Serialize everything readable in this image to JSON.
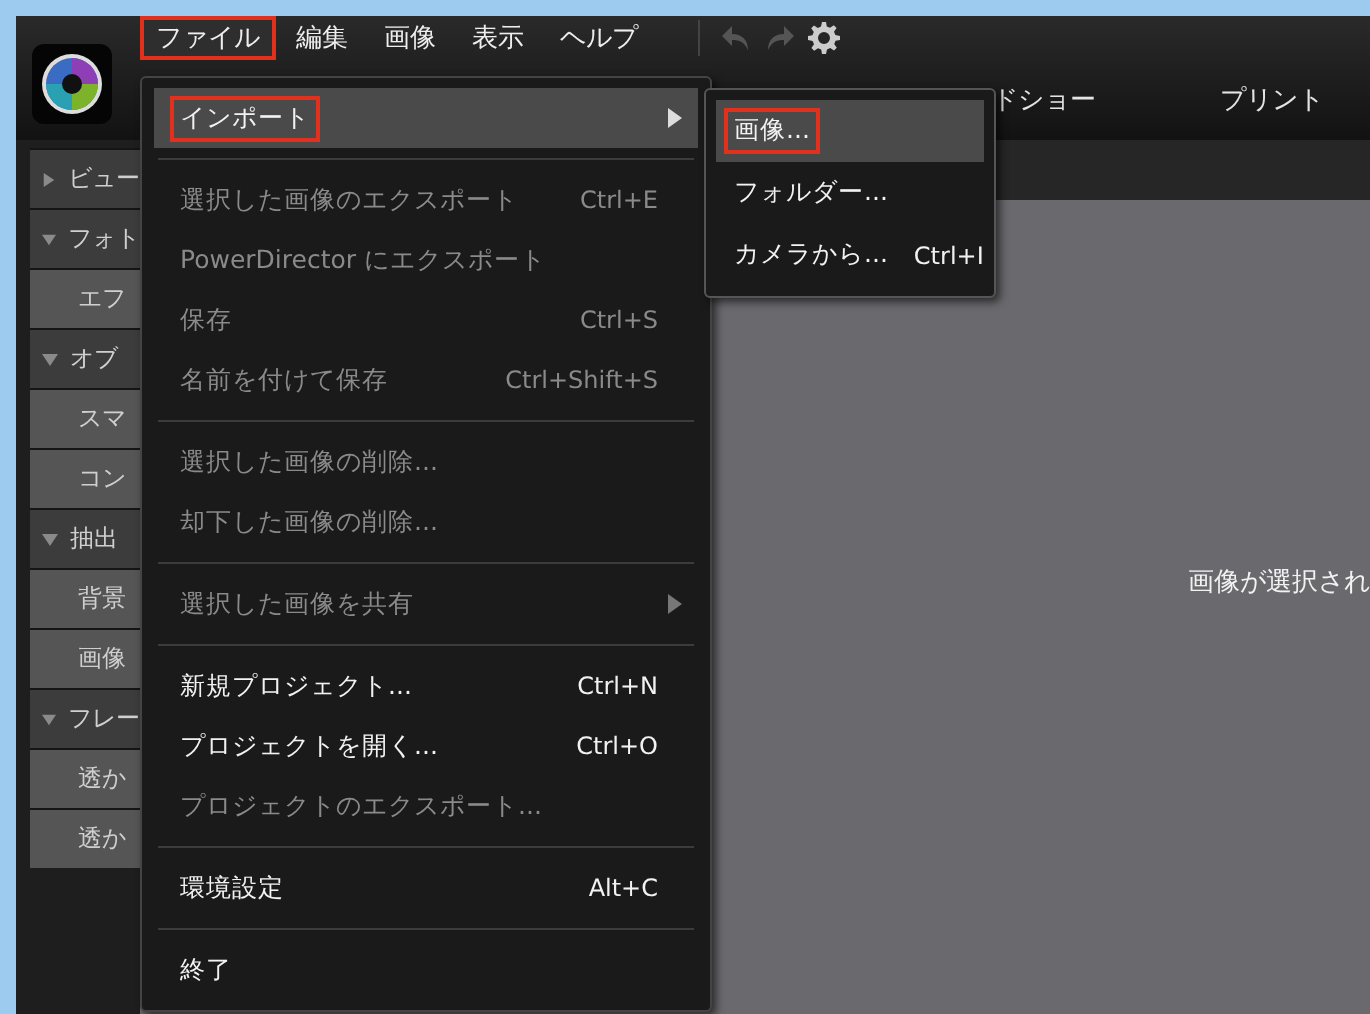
{
  "menubar": [
    {
      "label": "ファイル",
      "selected": true,
      "annotated": true
    },
    {
      "label": "編集",
      "selected": false,
      "annotated": false
    },
    {
      "label": "画像",
      "selected": false,
      "annotated": false
    },
    {
      "label": "表示",
      "selected": false,
      "annotated": false
    },
    {
      "label": "ヘルプ",
      "selected": false,
      "annotated": false
    }
  ],
  "tabs": [
    {
      "label": "ドショー",
      "selected": false
    },
    {
      "label": "プリント",
      "selected": false
    }
  ],
  "sidebar": [
    {
      "label": "ビュー",
      "kind": "header",
      "expanded": false
    },
    {
      "label": "フォト",
      "kind": "header",
      "expanded": true
    },
    {
      "label": "エフ",
      "kind": "item"
    },
    {
      "label": "オブ",
      "kind": "header",
      "expanded": true
    },
    {
      "label": "スマ",
      "kind": "item"
    },
    {
      "label": "コン",
      "kind": "item"
    },
    {
      "label": "抽出",
      "kind": "header",
      "expanded": true
    },
    {
      "label": "背景",
      "kind": "item"
    },
    {
      "label": "画像",
      "kind": "item"
    },
    {
      "label": "フレー",
      "kind": "header",
      "expanded": true
    },
    {
      "label": "透か",
      "kind": "item"
    },
    {
      "label": "透か",
      "kind": "item"
    }
  ],
  "main": {
    "message": "画像が選択され"
  },
  "file_menu": [
    {
      "kind": "item",
      "label": "インポート",
      "submenu": true,
      "disabled": false,
      "selected": true,
      "annotated": true
    },
    {
      "kind": "separator"
    },
    {
      "kind": "item",
      "label": "選択した画像のエクスポート",
      "shortcut": "Ctrl+E",
      "disabled": true,
      "selected": false,
      "annotated": false
    },
    {
      "kind": "item",
      "label": "PowerDirector にエクスポート",
      "disabled": true,
      "selected": false,
      "annotated": false
    },
    {
      "kind": "item",
      "label": "保存",
      "shortcut": "Ctrl+S",
      "disabled": true,
      "selected": false,
      "annotated": false
    },
    {
      "kind": "item",
      "label": "名前を付けて保存",
      "shortcut": "Ctrl+Shift+S",
      "disabled": true,
      "selected": false,
      "annotated": false
    },
    {
      "kind": "separator"
    },
    {
      "kind": "item",
      "label": "選択した画像の削除...",
      "disabled": true,
      "selected": false,
      "annotated": false
    },
    {
      "kind": "item",
      "label": "却下した画像の削除...",
      "disabled": true,
      "selected": false,
      "annotated": false
    },
    {
      "kind": "separator"
    },
    {
      "kind": "item",
      "label": "選択した画像を共有",
      "submenu": true,
      "disabled": true,
      "selected": false,
      "annotated": false
    },
    {
      "kind": "separator"
    },
    {
      "kind": "item",
      "label": "新規プロジェクト...",
      "shortcut": "Ctrl+N",
      "disabled": false,
      "selected": false,
      "annotated": false
    },
    {
      "kind": "item",
      "label": "プロジェクトを開く...",
      "shortcut": "Ctrl+O",
      "disabled": false,
      "selected": false,
      "annotated": false
    },
    {
      "kind": "item",
      "label": "プロジェクトのエクスポート...",
      "disabled": true,
      "selected": false,
      "annotated": false
    },
    {
      "kind": "separator"
    },
    {
      "kind": "item",
      "label": "環境設定",
      "shortcut": "Alt+C",
      "disabled": false,
      "selected": false,
      "annotated": false
    },
    {
      "kind": "separator"
    },
    {
      "kind": "item",
      "label": "終了",
      "disabled": false,
      "selected": false,
      "annotated": false
    }
  ],
  "import_submenu": [
    {
      "label": "画像...",
      "selected": true,
      "annotated": true
    },
    {
      "label": "フォルダー...",
      "selected": false,
      "annotated": false
    },
    {
      "label": "カメラから...",
      "shortcut": "Ctrl+I",
      "selected": false,
      "annotated": false
    }
  ]
}
